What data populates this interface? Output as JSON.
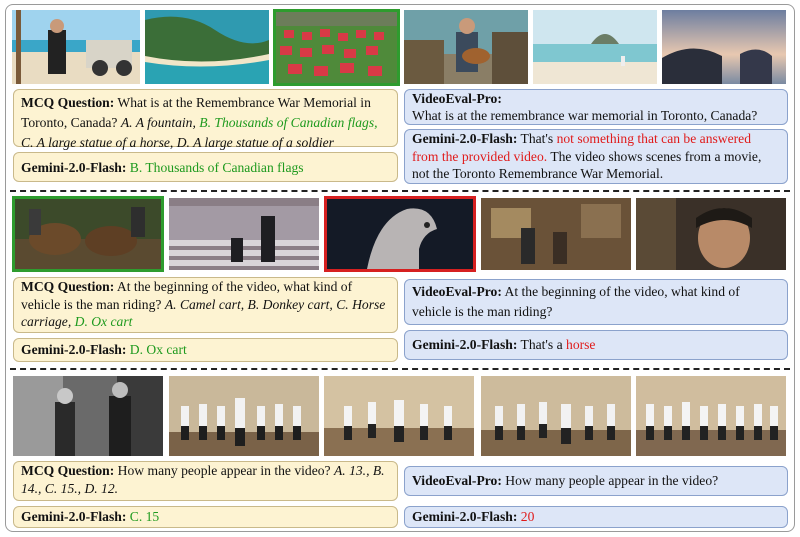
{
  "example1": {
    "mcq": {
      "label": "MCQ Question:",
      "text": "What is at the Remembrance War Memorial in Toronto, Canada?",
      "opt_a": "A. A fountain,",
      "opt_b": "B. Thousands of Canadian flags,",
      "opt_cd": "C. A large statue of a horse, D. A large statue of a soldier"
    },
    "gemini_mcq": {
      "label": "Gemini-2.0-Flash:",
      "answer": "B. Thousands of Canadian flags"
    },
    "videoeval": {
      "label": "VideoEval-Pro:",
      "text": "What is at the remembrance war memorial in Toronto, Canada?"
    },
    "gemini_open": {
      "label": "Gemini-2.0-Flash:",
      "prefix": "That's",
      "error": "not something that can be answered from the provided video.",
      "rest": "The video shows scenes from a movie, not the Toronto Remembrance War Memorial."
    }
  },
  "example2": {
    "mcq": {
      "label": "MCQ Question:",
      "text": "At the beginning of the video, what kind of vehicle is the man riding?",
      "opts": "A. Camel cart, B. Donkey cart, C. Horse carriage,",
      "correct": "D. Ox cart"
    },
    "gemini_mcq": {
      "label": "Gemini-2.0-Flash:",
      "answer": "D. Ox cart"
    },
    "videoeval": {
      "label": "VideoEval-Pro:",
      "text": "At the beginning of the video, what kind of vehicle is the man riding?"
    },
    "gemini_open": {
      "label": "Gemini-2.0-Flash:",
      "prefix": "That's a",
      "error": "horse"
    }
  },
  "example3": {
    "mcq": {
      "label": "MCQ Question:",
      "text": "How many people appear in the video?",
      "opts": "A. 13., B. 14., C. 15., D. 12."
    },
    "gemini_mcq": {
      "label": "Gemini-2.0-Flash:",
      "answer": "C. 15"
    },
    "videoeval": {
      "label": "VideoEval-Pro:",
      "text": "How many people appear in the video?"
    },
    "gemini_open": {
      "label": "Gemini-2.0-Flash:",
      "answer": "20"
    }
  },
  "colors": {
    "correct": "#1e9a1e",
    "wrong": "#e01b1b",
    "mcq_bg": "#fdf3d2",
    "open_bg": "#dde6f7"
  }
}
